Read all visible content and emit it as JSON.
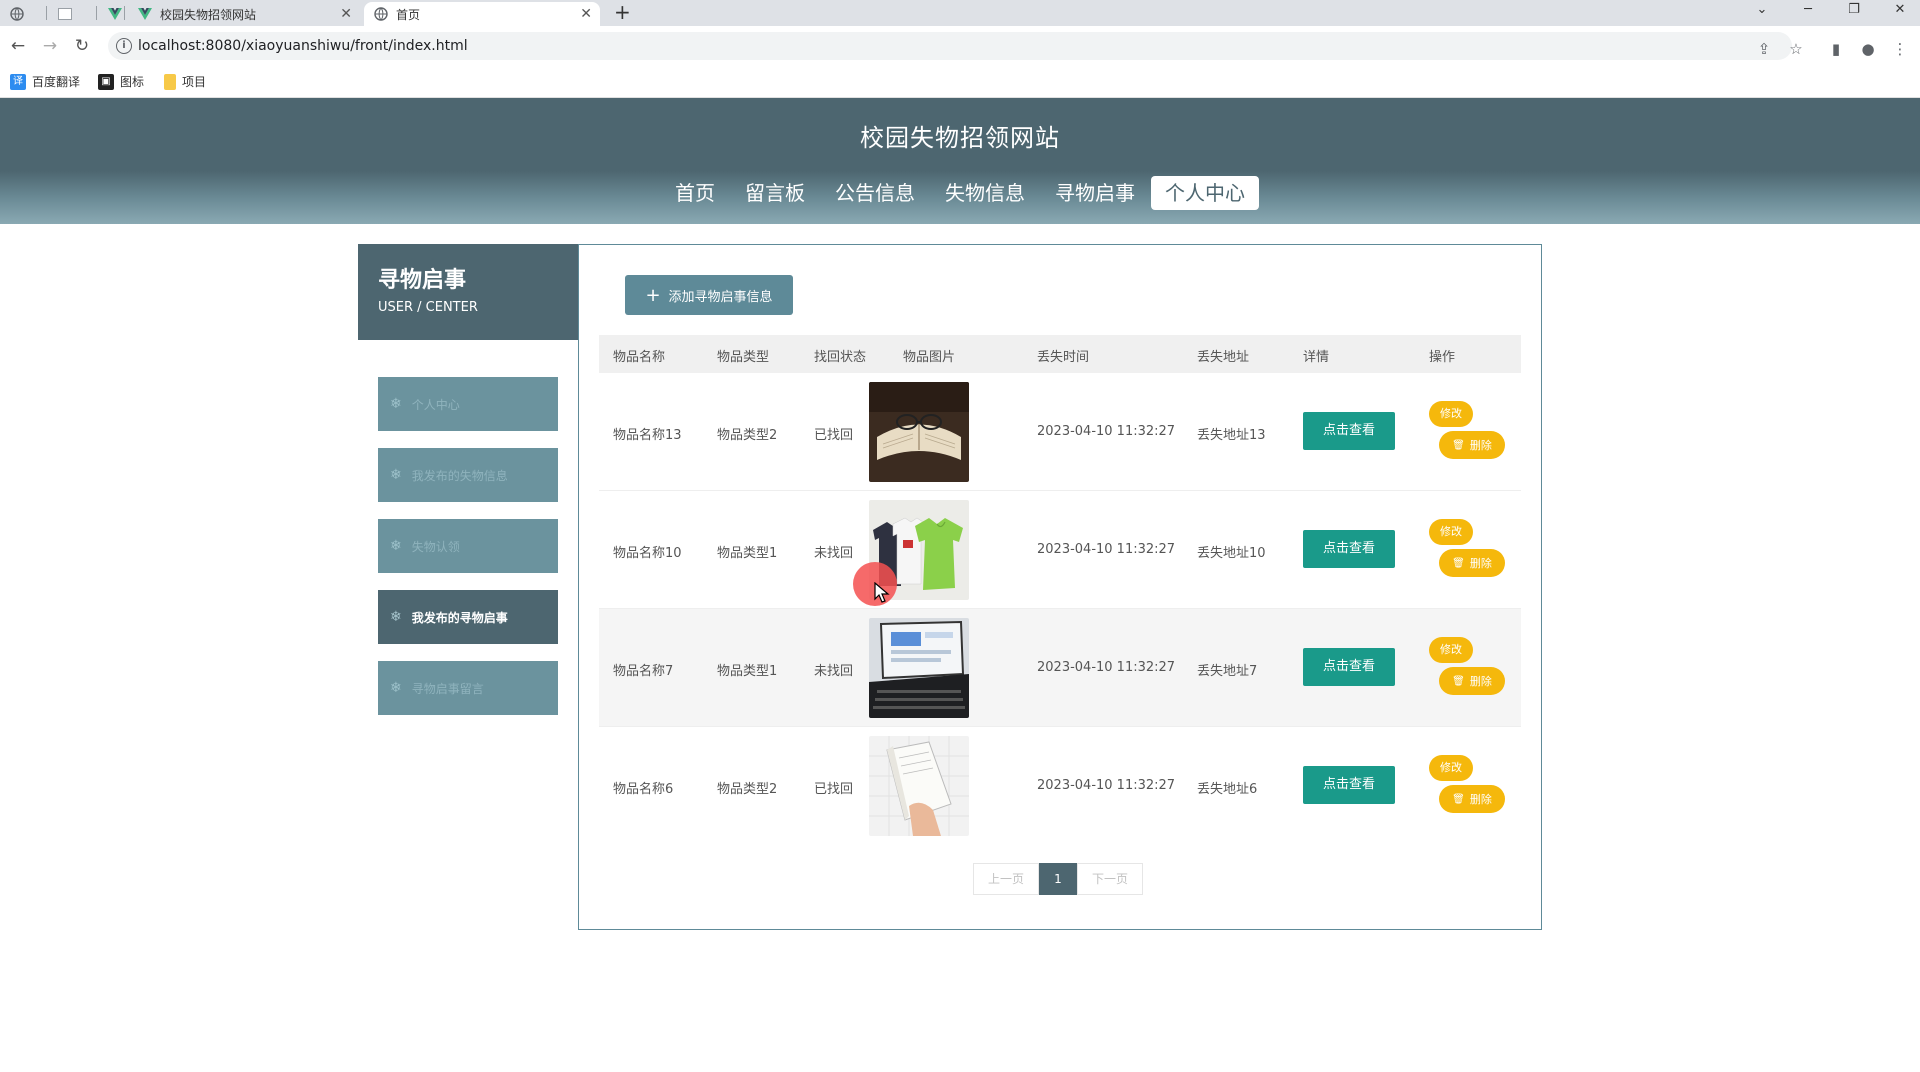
{
  "browser": {
    "tabs": [
      {
        "title": "",
        "favicon": "globe-icon"
      },
      {
        "title": "",
        "favicon": "blank-page-icon"
      },
      {
        "title": "",
        "favicon": "vue-logo-icon"
      },
      {
        "title": "校园失物招领网站",
        "favicon": "vue-logo-icon"
      },
      {
        "title": "首页",
        "favicon": "globe-icon"
      }
    ],
    "new_tab_label": "+",
    "close_label": "✕",
    "url": "localhost:8080/xiaoyuanshiwu/front/index.html",
    "bookmarks": [
      {
        "label": "百度翻译",
        "color": "#2d8cf0"
      },
      {
        "label": "图标",
        "color": "#222222"
      },
      {
        "label": "项目",
        "color": "#f7c948"
      }
    ]
  },
  "site": {
    "title": "校园失物招领网站",
    "nav": [
      "首页",
      "留言板",
      "公告信息",
      "失物信息",
      "寻物启事",
      "个人中心"
    ],
    "active_nav_index": 5
  },
  "sidebar": {
    "title": "寻物启事",
    "subtitle": "USER / CENTER",
    "items": [
      {
        "label": "个人中心"
      },
      {
        "label": "我发布的失物信息"
      },
      {
        "label": "失物认领"
      },
      {
        "label": "我发布的寻物启事"
      },
      {
        "label": "寻物启事留言"
      }
    ],
    "active_index": 3
  },
  "main": {
    "add_button": "添加寻物启事信息",
    "columns": [
      "物品名称",
      "物品类型",
      "找回状态",
      "物品图片",
      "丢失时间",
      "丢失地址",
      "详情",
      "操作"
    ],
    "rows": [
      {
        "name": "物品名称13",
        "type": "物品类型2",
        "status": "已找回",
        "image": "book-with-glasses",
        "time": "2023-04-10 11:32:27",
        "address": "丢失地址13"
      },
      {
        "name": "物品名称10",
        "type": "物品类型1",
        "status": "未找回",
        "image": "tshirts",
        "time": "2023-04-10 11:32:27",
        "address": "丢失地址10"
      },
      {
        "name": "物品名称7",
        "type": "物品类型1",
        "status": "未找回",
        "image": "laptop",
        "time": "2023-04-10 11:32:27",
        "address": "丢失地址7"
      },
      {
        "name": "物品名称6",
        "type": "物品类型2",
        "status": "已找回",
        "image": "open-book-hand",
        "time": "2023-04-10 11:32:27",
        "address": "丢失地址6"
      }
    ],
    "view_label": "点击查看",
    "edit_label": "修改",
    "delete_label": "删除",
    "pager": {
      "prev": "上一页",
      "current": "1",
      "next": "下一页"
    }
  },
  "colors": {
    "header": "#4d6670",
    "sidebar_item": "#6b939e",
    "view_button": "#1a9a8a",
    "action_button": "#f5b80c"
  }
}
